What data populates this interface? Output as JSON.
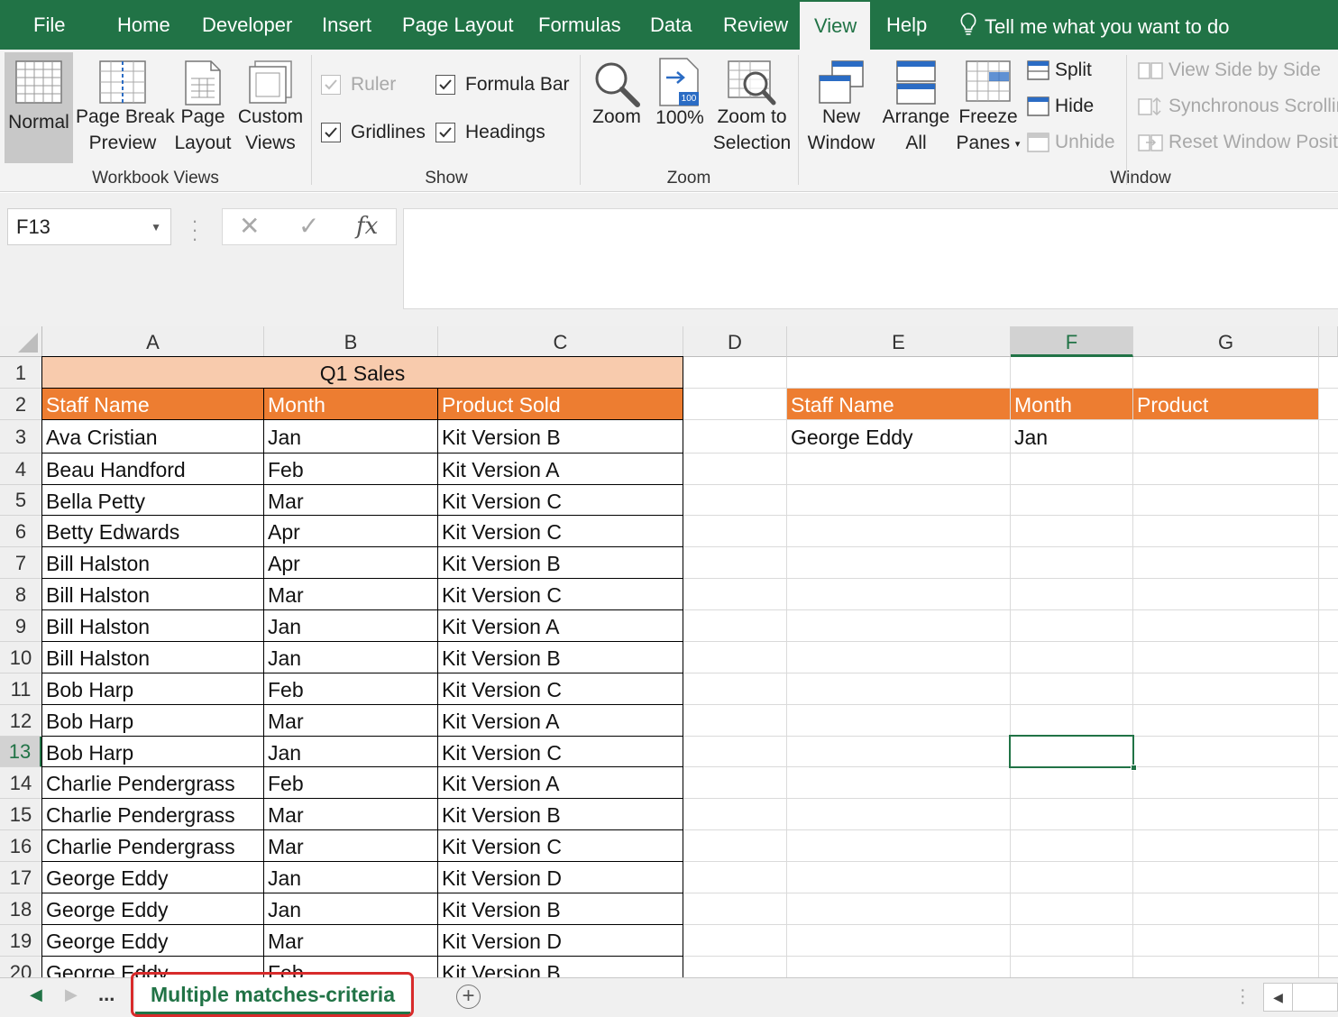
{
  "ribbon_tabs": [
    {
      "label": "File"
    },
    {
      "label": "Home"
    },
    {
      "label": "Developer"
    },
    {
      "label": "Insert"
    },
    {
      "label": "Page Layout"
    },
    {
      "label": "Formulas"
    },
    {
      "label": "Data"
    },
    {
      "label": "Review"
    },
    {
      "label": "View",
      "active": true
    },
    {
      "label": "Help"
    }
  ],
  "tell_me": "Tell me what you want to do",
  "workbook_views": {
    "group_label": "Workbook Views",
    "normal": "Normal",
    "page_break_1": "Page Break",
    "page_break_2": "Preview",
    "page_layout_1": "Page",
    "page_layout_2": "Layout",
    "custom_views_1": "Custom",
    "custom_views_2": "Views"
  },
  "show": {
    "group_label": "Show",
    "ruler": {
      "label": "Ruler",
      "checked": true,
      "disabled": true
    },
    "formula_bar": {
      "label": "Formula Bar",
      "checked": true
    },
    "gridlines": {
      "label": "Gridlines",
      "checked": true
    },
    "headings": {
      "label": "Headings",
      "checked": true
    }
  },
  "zoom": {
    "group_label": "Zoom",
    "zoom": "Zoom",
    "hundred": "100%",
    "hundred_icon_text": "100",
    "selection_1": "Zoom to",
    "selection_2": "Selection"
  },
  "window": {
    "group_label": "Window",
    "new_window_1": "New",
    "new_window_2": "Window",
    "arrange_1": "Arrange",
    "arrange_2": "All",
    "freeze_1": "Freeze",
    "freeze_2": "Panes",
    "split": "Split",
    "hide": "Hide",
    "unhide": "Unhide",
    "side_by_side": "View Side by Side",
    "sync_scroll": "Synchronous Scrolling",
    "reset_position": "Reset Window Position"
  },
  "formula_bar": {
    "name_box": "F13",
    "cancel_symbol": "✕",
    "enter_symbol": "✓",
    "fx_symbol": "fx",
    "content": ""
  },
  "columns": [
    "A",
    "B",
    "C",
    "D",
    "E",
    "F",
    "G"
  ],
  "selected_column": "F",
  "selected_row": 13,
  "table1": {
    "title": "Q1 Sales",
    "headers": [
      "Staff Name",
      "Month",
      "Product Sold"
    ],
    "rows": [
      [
        "Ava Cristian",
        "Jan",
        "Kit Version B"
      ],
      [
        "Beau Handford",
        "Feb",
        "Kit Version A"
      ],
      [
        "Bella Petty",
        "Mar",
        "Kit Version C"
      ],
      [
        "Betty Edwards",
        "Apr",
        "Kit Version C"
      ],
      [
        "Bill Halston",
        "Apr",
        "Kit Version B"
      ],
      [
        "Bill Halston",
        "Mar",
        "Kit Version C"
      ],
      [
        "Bill Halston",
        "Jan",
        "Kit Version A"
      ],
      [
        "Bill Halston",
        "Jan",
        "Kit Version B"
      ],
      [
        "Bob Harp",
        "Feb",
        "Kit Version C"
      ],
      [
        "Bob Harp",
        "Mar",
        "Kit Version A"
      ],
      [
        "Bob Harp",
        "Jan",
        "Kit Version C"
      ],
      [
        "Charlie Pendergrass",
        "Feb",
        "Kit Version A"
      ],
      [
        "Charlie Pendergrass",
        "Mar",
        "Kit Version B"
      ],
      [
        "Charlie Pendergrass",
        "Mar",
        "Kit Version C"
      ],
      [
        "George Eddy",
        "Jan",
        "Kit Version D"
      ],
      [
        "George Eddy",
        "Jan",
        "Kit Version B"
      ],
      [
        "George Eddy",
        "Mar",
        "Kit Version D"
      ],
      [
        "George Eddy",
        "Feb",
        "Kit Version B"
      ]
    ]
  },
  "table2": {
    "headers": [
      "Staff Name",
      "Month",
      "Product"
    ],
    "row": [
      "George Eddy",
      "Jan",
      ""
    ]
  },
  "sheet_tab": "Multiple matches-criteria",
  "sheet_nav_ellipsis": "...",
  "add_sheet_symbol": "+",
  "colors": {
    "excel_green": "#217346",
    "title_fill": "#f8cbad",
    "header_fill": "#ed7d31",
    "highlight_red": "#d82b2b"
  }
}
